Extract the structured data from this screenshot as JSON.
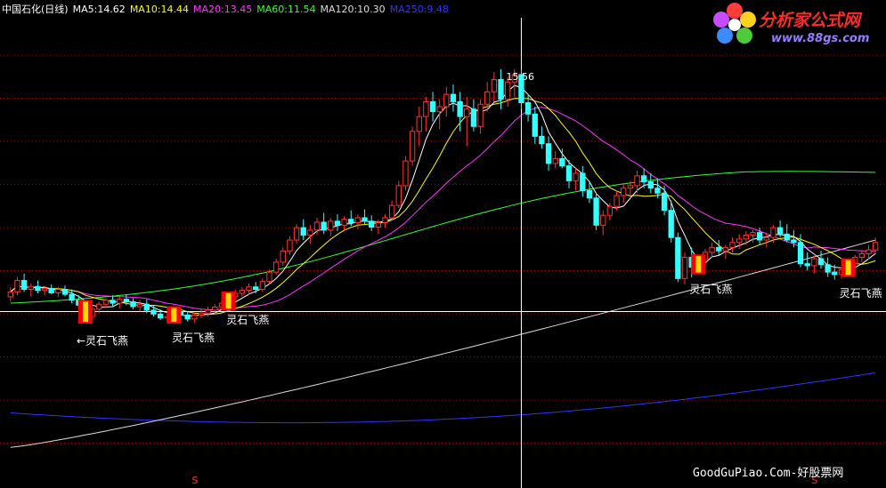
{
  "header": {
    "title": "中国石化(日线)",
    "ma5": "MA5:14.62",
    "ma10": "MA10:14.44",
    "ma20": "MA20:13.45",
    "ma60": "MA60:11.54",
    "ma120": "MA120:10.30",
    "ma250": "MA250:9.48"
  },
  "logo": {
    "title": "分析家公式网",
    "url": "www.88gs.com"
  },
  "footer": {
    "text": "GoodGuPiao.Com-好股票网"
  },
  "colors": {
    "ma5": "#ffffff",
    "ma10": "#ffff00",
    "ma20": "#ff33ff",
    "ma60": "#33ff33",
    "ma120": "#dddddd",
    "ma250": "#3333ff",
    "up": "#ff3333",
    "down": "#33ffff",
    "grid": "#aa0000",
    "text": "#ffffff"
  },
  "chart_data": {
    "type": "candlestick",
    "ylim": [
      7.6,
      16.6
    ],
    "n_bars": 132,
    "peak_label": "15.56",
    "signal_label": "灵石飞燕",
    "annotations": [
      {
        "bar": 11,
        "text": "←灵石飞燕"
      },
      {
        "bar": 25,
        "text": "灵石飞燕"
      },
      {
        "bar": 33,
        "text": "灵石飞燕"
      },
      {
        "bar": 101,
        "text": "灵石飞燕"
      },
      {
        "bar": 123,
        "text": "灵石飞燕"
      }
    ],
    "signal_bars": [
      11,
      24,
      32,
      101,
      123
    ],
    "s_markers": [
      {
        "bar": 27,
        "text": "S"
      },
      {
        "bar": 118,
        "text": "S"
      }
    ],
    "crosshair_bar": 75,
    "crosshair_price": 10.65,
    "candles": [
      [
        10.95,
        11.15,
        10.85,
        11.05
      ],
      [
        11.05,
        11.35,
        10.98,
        11.28
      ],
      [
        11.28,
        11.42,
        11.05,
        11.1
      ],
      [
        11.1,
        11.22,
        10.95,
        11.16
      ],
      [
        11.16,
        11.28,
        11.02,
        11.08
      ],
      [
        11.08,
        11.16,
        10.98,
        11.12
      ],
      [
        11.12,
        11.2,
        11.0,
        11.03
      ],
      [
        11.03,
        11.15,
        10.95,
        11.1
      ],
      [
        11.1,
        11.18,
        10.96,
        11.0
      ],
      [
        11.0,
        11.1,
        10.82,
        10.88
      ],
      [
        10.88,
        10.98,
        10.7,
        10.78
      ],
      [
        10.78,
        10.86,
        10.45,
        10.55
      ],
      [
        10.55,
        10.75,
        10.48,
        10.7
      ],
      [
        10.7,
        10.85,
        10.62,
        10.8
      ],
      [
        10.8,
        10.92,
        10.72,
        10.88
      ],
      [
        10.88,
        10.98,
        10.75,
        10.82
      ],
      [
        10.82,
        10.95,
        10.72,
        10.9
      ],
      [
        10.9,
        11.0,
        10.78,
        10.85
      ],
      [
        10.85,
        10.92,
        10.7,
        10.75
      ],
      [
        10.75,
        10.88,
        10.65,
        10.8
      ],
      [
        10.8,
        10.9,
        10.62,
        10.68
      ],
      [
        10.68,
        10.78,
        10.55,
        10.6
      ],
      [
        10.6,
        10.7,
        10.48,
        10.52
      ],
      [
        10.52,
        10.62,
        10.42,
        10.55
      ],
      [
        10.55,
        10.7,
        10.5,
        10.65
      ],
      [
        10.65,
        10.72,
        10.52,
        10.58
      ],
      [
        10.58,
        10.66,
        10.45,
        10.5
      ],
      [
        10.5,
        10.62,
        10.42,
        10.58
      ],
      [
        10.58,
        10.7,
        10.52,
        10.62
      ],
      [
        10.62,
        10.75,
        10.55,
        10.68
      ],
      [
        10.68,
        10.8,
        10.6,
        10.74
      ],
      [
        10.74,
        10.88,
        10.68,
        10.82
      ],
      [
        10.82,
        11.0,
        10.78,
        10.95
      ],
      [
        10.95,
        11.1,
        10.88,
        11.02
      ],
      [
        11.02,
        11.15,
        10.95,
        11.08
      ],
      [
        11.08,
        11.22,
        11.0,
        11.15
      ],
      [
        11.15,
        11.25,
        11.02,
        11.1
      ],
      [
        11.1,
        11.32,
        11.05,
        11.26
      ],
      [
        11.26,
        11.5,
        11.2,
        11.45
      ],
      [
        11.45,
        11.72,
        11.4,
        11.65
      ],
      [
        11.65,
        11.95,
        11.58,
        11.88
      ],
      [
        11.88,
        12.18,
        11.8,
        12.1
      ],
      [
        12.1,
        12.42,
        12.02,
        12.35
      ],
      [
        12.35,
        12.52,
        12.1,
        12.2
      ],
      [
        12.2,
        12.4,
        12.02,
        12.3
      ],
      [
        12.3,
        12.55,
        12.2,
        12.46
      ],
      [
        12.46,
        12.65,
        12.22,
        12.3
      ],
      [
        12.3,
        12.55,
        12.18,
        12.48
      ],
      [
        12.48,
        12.62,
        12.28,
        12.4
      ],
      [
        12.4,
        12.58,
        12.3,
        12.52
      ],
      [
        12.52,
        12.7,
        12.38,
        12.45
      ],
      [
        12.45,
        12.62,
        12.32,
        12.55
      ],
      [
        12.55,
        12.72,
        12.4,
        12.48
      ],
      [
        12.48,
        12.6,
        12.28,
        12.36
      ],
      [
        12.36,
        12.52,
        12.22,
        12.45
      ],
      [
        12.45,
        12.62,
        12.35,
        12.55
      ],
      [
        12.55,
        12.9,
        12.5,
        12.8
      ],
      [
        12.8,
        13.3,
        12.75,
        13.2
      ],
      [
        13.2,
        13.8,
        13.1,
        13.7
      ],
      [
        13.7,
        14.4,
        13.6,
        14.3
      ],
      [
        14.3,
        14.8,
        14.0,
        14.6
      ],
      [
        14.6,
        15.0,
        14.3,
        14.9
      ],
      [
        14.9,
        15.1,
        14.5,
        14.7
      ],
      [
        14.7,
        14.95,
        14.35,
        14.8
      ],
      [
        14.8,
        15.2,
        14.6,
        15.05
      ],
      [
        15.05,
        15.25,
        14.7,
        14.9
      ],
      [
        14.9,
        15.1,
        14.3,
        14.6
      ],
      [
        14.6,
        15.0,
        14.0,
        14.75
      ],
      [
        14.75,
        14.95,
        14.3,
        14.4
      ],
      [
        14.4,
        14.95,
        14.25,
        14.85
      ],
      [
        14.85,
        15.3,
        14.7,
        15.1
      ],
      [
        15.1,
        15.5,
        14.9,
        15.35
      ],
      [
        15.35,
        15.56,
        14.75,
        14.95
      ],
      [
        14.95,
        15.4,
        14.8,
        15.3
      ],
      [
        15.3,
        15.56,
        15.0,
        15.45
      ],
      [
        15.45,
        15.55,
        14.75,
        14.88
      ],
      [
        14.88,
        15.05,
        14.5,
        14.65
      ],
      [
        14.65,
        14.8,
        14.05,
        14.2
      ],
      [
        14.2,
        14.4,
        13.95,
        14.05
      ],
      [
        14.05,
        14.2,
        13.5,
        13.65
      ],
      [
        13.65,
        13.9,
        13.55,
        13.75
      ],
      [
        13.75,
        13.95,
        13.55,
        13.6
      ],
      [
        13.6,
        13.72,
        13.15,
        13.3
      ],
      [
        13.3,
        13.55,
        13.1,
        13.45
      ],
      [
        13.45,
        13.6,
        12.98,
        13.1
      ],
      [
        13.1,
        13.3,
        12.85,
        12.95
      ],
      [
        12.95,
        13.05,
        12.3,
        12.4
      ],
      [
        12.4,
        12.7,
        12.2,
        12.6
      ],
      [
        12.6,
        12.85,
        12.5,
        12.78
      ],
      [
        12.78,
        13.1,
        12.7,
        13.0
      ],
      [
        13.0,
        13.25,
        12.85,
        13.15
      ],
      [
        13.15,
        13.3,
        12.95,
        13.2
      ],
      [
        13.2,
        13.5,
        13.05,
        13.4
      ],
      [
        13.4,
        13.55,
        13.15,
        13.28
      ],
      [
        13.28,
        13.45,
        13.05,
        13.15
      ],
      [
        13.15,
        13.35,
        12.95,
        13.05
      ],
      [
        13.05,
        13.2,
        12.6,
        12.7
      ],
      [
        12.7,
        12.9,
        12.05,
        12.15
      ],
      [
        12.15,
        12.25,
        11.25,
        11.32
      ],
      [
        11.32,
        11.85,
        11.2,
        11.75
      ],
      [
        11.75,
        11.95,
        11.35,
        11.55
      ],
      [
        11.55,
        11.8,
        11.5,
        11.7
      ],
      [
        11.7,
        11.92,
        11.6,
        11.85
      ],
      [
        11.85,
        12.05,
        11.75,
        11.95
      ],
      [
        11.95,
        12.1,
        11.78,
        11.88
      ],
      [
        11.88,
        12.0,
        11.72,
        11.95
      ],
      [
        11.95,
        12.15,
        11.85,
        12.05
      ],
      [
        12.05,
        12.22,
        11.92,
        12.12
      ],
      [
        12.12,
        12.28,
        12.0,
        12.2
      ],
      [
        12.2,
        12.3,
        12.05,
        12.25
      ],
      [
        12.25,
        12.35,
        12.0,
        12.1
      ],
      [
        12.1,
        12.25,
        11.95,
        12.15
      ],
      [
        12.15,
        12.4,
        12.05,
        12.35
      ],
      [
        12.35,
        12.5,
        12.15,
        12.22
      ],
      [
        12.22,
        12.42,
        12.05,
        12.1
      ],
      [
        12.1,
        12.3,
        11.95,
        12.05
      ],
      [
        12.05,
        12.22,
        11.55,
        11.62
      ],
      [
        11.62,
        11.85,
        11.48,
        11.58
      ],
      [
        11.58,
        11.78,
        11.42,
        11.72
      ],
      [
        11.72,
        11.88,
        11.52,
        11.6
      ],
      [
        11.6,
        11.75,
        11.35,
        11.45
      ],
      [
        11.45,
        11.6,
        11.3,
        11.4
      ],
      [
        11.4,
        11.55,
        11.32,
        11.5
      ],
      [
        11.5,
        11.68,
        11.42,
        11.62
      ],
      [
        11.62,
        11.8,
        11.52,
        11.75
      ],
      [
        11.75,
        11.9,
        11.65,
        11.82
      ],
      [
        11.82,
        12.0,
        11.7,
        11.9
      ],
      [
        11.9,
        12.15,
        11.8,
        12.05
      ]
    ]
  }
}
